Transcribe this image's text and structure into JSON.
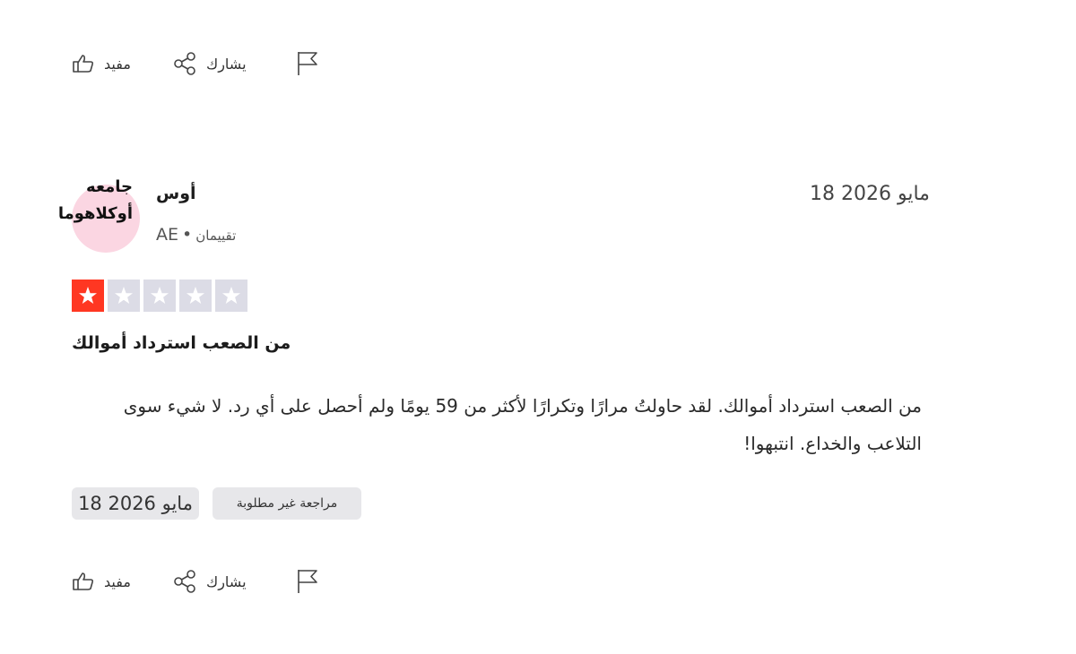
{
  "top_actions": {
    "helpful_label": "مفيد",
    "share_label": "يشارك"
  },
  "review": {
    "avatar_text": "جامعه أوكلاهوما",
    "reviewer_name": "أوس",
    "country": "AE",
    "reviews_count": "تقييمان",
    "date": "18 مايو 2026",
    "rating": 1,
    "rating_max": 5,
    "title": "من الصعب استرداد أموالك",
    "body": "من الصعب استرداد أموالك. لقد حاولتُ مرارًا وتكرارًا لأكثر من 59 يومًا ولم أحصل على أي رد. لا شيء سوى التلاعب والخداع. انتبهوا!",
    "tag_date": "18 مايو 2026",
    "tag_unsolicited": "مراجعة غير مطلوبة"
  },
  "bottom_actions": {
    "helpful_label": "مفيد",
    "share_label": "يشارك"
  },
  "colors": {
    "star_filled": "#ff3722",
    "star_empty": "#dcdce6",
    "avatar_bg": "#fbd6e2",
    "tag_bg": "#e7e7ea"
  },
  "icons": [
    "thumbs-up-icon",
    "share-icon",
    "flag-icon",
    "star-icon"
  ]
}
